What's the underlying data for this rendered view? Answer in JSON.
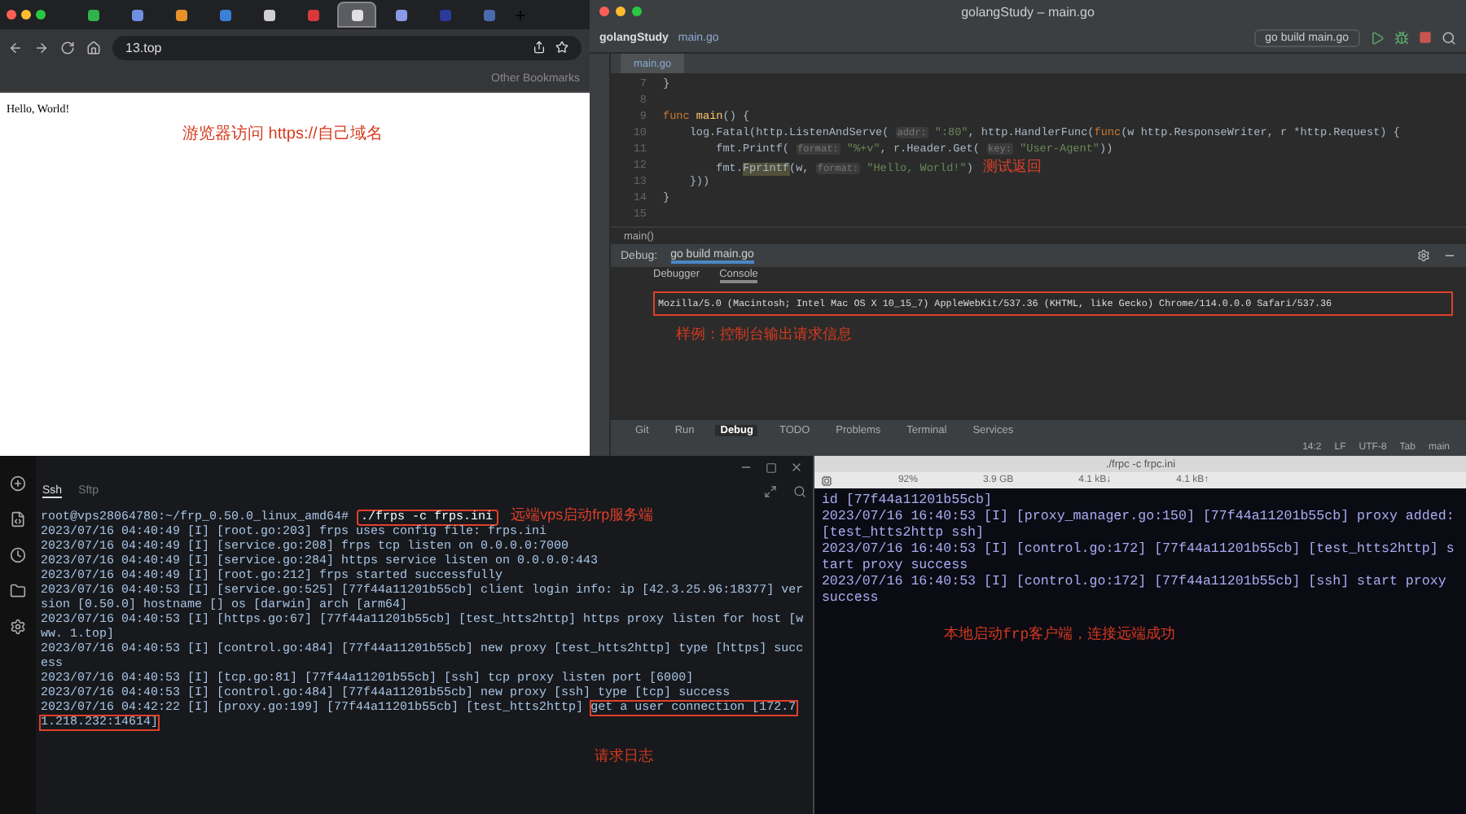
{
  "browser": {
    "tabs": [
      {
        "color": "#2fb34a",
        "selected": false
      },
      {
        "color": "#6f8fe0",
        "selected": false
      },
      {
        "color": "#e8902a",
        "selected": false
      },
      {
        "color": "#3a7fd8",
        "selected": false
      },
      {
        "color": "#d0d0d0",
        "selected": false
      },
      {
        "color": "#d83a3a",
        "selected": false
      },
      {
        "color": "#e0e0e0",
        "selected": true
      },
      {
        "color": "#8a9ae8",
        "selected": false
      },
      {
        "color": "#2a3a9a",
        "selected": false
      },
      {
        "color": "#4a6ab0",
        "selected": false
      }
    ],
    "address": "13.top",
    "bookmarks_other": "Other Bookmarks",
    "page_text": "Hello, World!",
    "annotation": "游览器访问 https://自己域名"
  },
  "ide": {
    "title": "golangStudy – main.go",
    "project": "golangStudy",
    "file": "main.go",
    "run_config": "go build main.go",
    "editor_tab": "main.go",
    "code": [
      {
        "number": "7",
        "segments": [
          {
            "kind": "plain",
            "text": "}"
          }
        ]
      },
      {
        "number": "8"
      },
      {
        "number": "9",
        "segments": [
          {
            "kind": "kw",
            "text": "func "
          },
          {
            "kind": "fn",
            "text": "main"
          },
          {
            "kind": "plain",
            "text": "() {"
          }
        ]
      },
      {
        "number": "10",
        "segments": [
          {
            "kind": "plain",
            "text": "    log.Fatal(http.ListenAndServe( "
          },
          {
            "kind": "hint",
            "text": "addr:"
          },
          {
            "kind": "str",
            "text": " \":80\""
          },
          {
            "kind": "plain",
            "text": ", http.HandlerFunc("
          },
          {
            "kind": "kw",
            "text": "func"
          },
          {
            "kind": "plain",
            "text": "(w http.ResponseWriter, r *http.Request) {"
          }
        ]
      },
      {
        "number": "11",
        "segments": [
          {
            "kind": "plain",
            "text": "        fmt.Printf( "
          },
          {
            "kind": "hint",
            "text": "format:"
          },
          {
            "kind": "str",
            "text": " \"%+v\""
          },
          {
            "kind": "plain",
            "text": ", r.Header.Get( "
          },
          {
            "kind": "hint",
            "text": "key:"
          },
          {
            "kind": "str",
            "text": " \"User-Agent\""
          },
          {
            "kind": "plain",
            "text": "))"
          }
        ]
      },
      {
        "number": "12",
        "segments": [
          {
            "kind": "plain",
            "text": "        fmt."
          },
          {
            "kind": "warn",
            "text": "Fprintf"
          },
          {
            "kind": "plain",
            "text": "(w, "
          },
          {
            "kind": "hint",
            "text": "format:"
          },
          {
            "kind": "str",
            "text": " \"Hello, World!\""
          },
          {
            "kind": "plain",
            "text": ")"
          },
          {
            "kind": "note",
            "text": "测试返回"
          }
        ]
      },
      {
        "number": "13",
        "segments": [
          {
            "kind": "plain",
            "text": "    }))"
          }
        ]
      },
      {
        "number": "14",
        "segments": [
          {
            "kind": "plain",
            "text": "}"
          }
        ]
      },
      {
        "number": "15"
      }
    ],
    "breadcrumb": "main()",
    "debug_label": "Debug:",
    "debug_tab": "go build main.go",
    "console_tabs": [
      {
        "label": "Debugger",
        "selected": false
      },
      {
        "label": "Console",
        "selected": true
      }
    ],
    "console_output": "Mozilla/5.0 (Macintosh; Intel Mac OS X 10_15_7) AppleWebKit/537.36 (KHTML, like Gecko) Chrome/114.0.0.0 Safari/537.36",
    "annotation": "样例：控制台输出请求信息",
    "tool_tabs": [
      {
        "label": "Git",
        "selected": false
      },
      {
        "label": "Run",
        "selected": false
      },
      {
        "label": "Debug",
        "selected": true
      },
      {
        "label": "TODO",
        "selected": false
      },
      {
        "label": "Problems",
        "selected": false
      },
      {
        "label": "Terminal",
        "selected": false
      },
      {
        "label": "Services",
        "selected": false
      }
    ],
    "status": [
      "14:2",
      "LF",
      "UTF-8",
      "Tab",
      "main"
    ]
  },
  "server_terminal": {
    "tabs": [
      {
        "label": "Ssh",
        "selected": true
      },
      {
        "label": "Sftp",
        "selected": false
      }
    ],
    "prompt": "root@vps28064780:~/frp_0.50.0_linux_amd64#",
    "command": "./frps -c frps.ini",
    "command_note": "远端vps启动frp服务端",
    "lines": [
      {
        "text": "2023/07/16 04:40:49 [I] [root.go:203] frps uses config file: frps.ini"
      },
      {
        "text": "2023/07/16 04:40:49 [I] [service.go:208] frps tcp listen on 0.0.0.0:7000"
      },
      {
        "text": "2023/07/16 04:40:49 [I] [service.go:284] https service listen on 0.0.0.0:443"
      },
      {
        "text": "2023/07/16 04:40:49 [I] [root.go:212] frps started successfully"
      },
      {
        "text": "2023/07/16 04:40:53 [I] [service.go:525] [77f44a11201b55cb] client login info: ip [42.3.25.96:18377] version [0.50.0] hostname [] os [darwin] arch [arm64]"
      },
      {
        "text": "2023/07/16 04:40:53 [I] [https.go:67] [77f44a11201b55cb] [test_htts2http] https proxy listen for host [www. 1.top]"
      },
      {
        "text": "2023/07/16 04:40:53 [I] [control.go:484] [77f44a11201b55cb] new proxy [test_htts2http] type [https] success"
      },
      {
        "text": "2023/07/16 04:40:53 [I] [tcp.go:81] [77f44a11201b55cb] [ssh] tcp proxy listen port [6000]"
      },
      {
        "text": "2023/07/16 04:40:53 [I] [control.go:484] [77f44a11201b55cb] new proxy [ssh] type [tcp] success"
      },
      {
        "text": "2023/07/16 04:42:22 [I] [proxy.go:199] [77f44a11201b55cb] [test_htts2http] ",
        "highlight": "get a user connection [172.71.218.232:14614]"
      }
    ],
    "log_note": "请求日志"
  },
  "client_terminal": {
    "title": "./frpc -c frpc.ini",
    "cpu": "92%",
    "memory": "3.9 GB",
    "net_down": "4.1 kB↓",
    "net_up": "4.1 kB↑",
    "lines": [
      "id [77f44a11201b55cb]",
      "2023/07/16 16:40:53 [I] [proxy_manager.go:150] [77f44a11201b55cb] proxy added: [test_htts2http ssh]",
      "2023/07/16 16:40:53 [I] [control.go:172] [77f44a11201b55cb] [test_htts2http] start proxy success",
      "2023/07/16 16:40:53 [I] [control.go:172] [77f44a11201b55cb] [ssh] start proxy success"
    ],
    "note": "本地启动frp客户端，连接远端成功"
  }
}
